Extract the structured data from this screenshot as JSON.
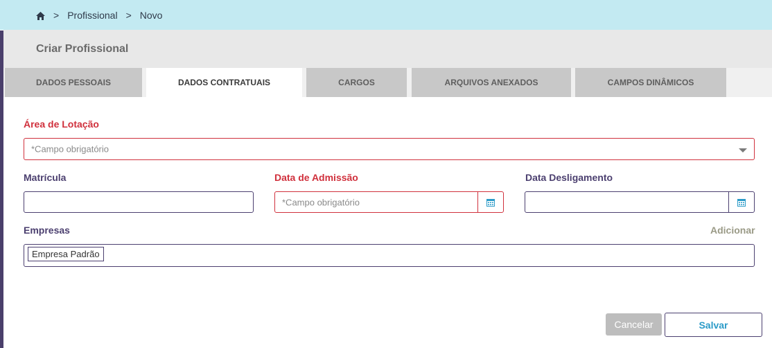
{
  "breadcrumb": {
    "home_icon": "home-icon",
    "items": [
      "Profissional",
      "Novo"
    ],
    "separator": ">"
  },
  "page": {
    "title": "Criar Profissional"
  },
  "tabs": [
    {
      "label": "DADOS PESSOAIS",
      "active": false
    },
    {
      "label": "DADOS CONTRATUAIS",
      "active": true
    },
    {
      "label": "CARGOS",
      "active": false
    },
    {
      "label": "ARQUIVOS ANEXADOS",
      "active": false
    },
    {
      "label": "CAMPOS DINÂMICOS",
      "active": false
    }
  ],
  "form": {
    "area_lotacao": {
      "label": "Área de Lotação",
      "placeholder": "*Campo obrigatório",
      "required": true
    },
    "matricula": {
      "label": "Matrícula",
      "value": ""
    },
    "data_admissao": {
      "label": "Data de Admissão",
      "placeholder": "*Campo obrigatório",
      "required": true
    },
    "data_desligamento": {
      "label": "Data Desligamento",
      "value": ""
    },
    "empresas": {
      "label": "Empresas",
      "add_label": "Adicionar",
      "chips": [
        "Empresa Padrão"
      ]
    }
  },
  "actions": {
    "cancel_label": "Cancelar",
    "save_label": "Salvar"
  },
  "colors": {
    "breadcrumb_bg": "#c3eaf2",
    "required": "#d0303c",
    "label": "#4b3f6f",
    "accent": "#2b9bc8"
  }
}
